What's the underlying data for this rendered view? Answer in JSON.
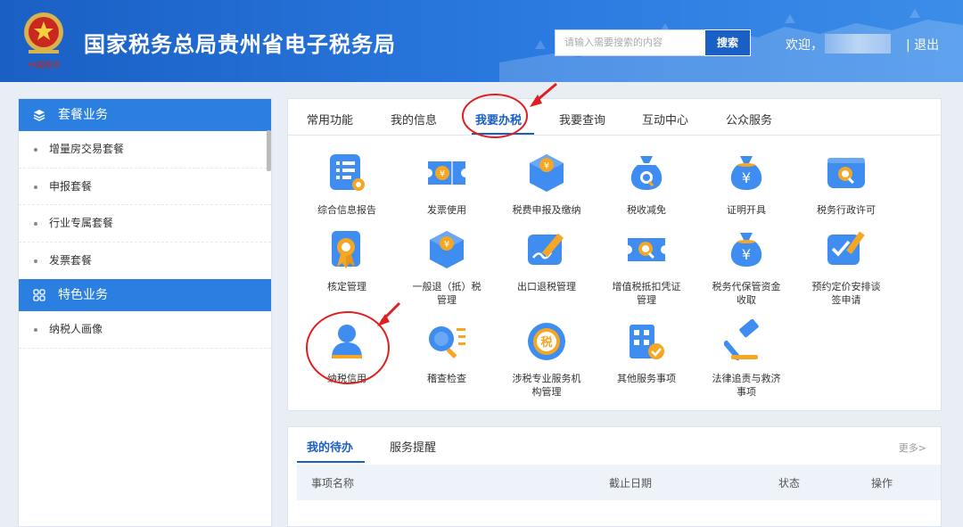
{
  "header": {
    "title": "国家税务总局贵州省电子税务局",
    "emblem_caption": "中国税务",
    "search_placeholder": "请输入需要搜索的内容",
    "search_button": "搜索",
    "welcome": "欢迎，",
    "logout": "| 退出",
    "brand_color": "#1a5fc4"
  },
  "sidebar": {
    "section1": {
      "title": "套餐业务",
      "icon": "layers-icon"
    },
    "section1_items": [
      "增量房交易套餐",
      "申报套餐",
      "行业专属套餐",
      "发票套餐"
    ],
    "section2": {
      "title": "特色业务",
      "icon": "grid-icon"
    },
    "section2_items": [
      "纳税人画像"
    ]
  },
  "tabs": {
    "items": [
      "常用功能",
      "我的信息",
      "我要办税",
      "我要查询",
      "互动中心",
      "公众服务"
    ],
    "active": "我要办税"
  },
  "functions": {
    "row1": [
      "综合信息报告",
      "发票使用",
      "税费申报及缴纳",
      "税收减免",
      "证明开具",
      "税务行政许可"
    ],
    "row2": [
      "核定管理",
      "一般退（抵）税",
      "出口退税管理",
      "增值税抵扣凭证",
      "税务代保管资金",
      "预约定价安排谈"
    ],
    "row2_line2": [
      "",
      "管理",
      "",
      "管理",
      "收取",
      "签申请"
    ],
    "row3": [
      "纳税信用",
      "稽查检查",
      "涉税专业服务机",
      "其他服务事项",
      "法律追责与救济"
    ],
    "row3_line2": [
      "",
      "",
      "构管理",
      "",
      "事项"
    ]
  },
  "todo": {
    "tabs": [
      "我的待办",
      "服务提醒"
    ],
    "more": "更多>",
    "columns": [
      "事项名称",
      "截止日期",
      "状态",
      "操作"
    ]
  },
  "annotation_color": "#e02020"
}
